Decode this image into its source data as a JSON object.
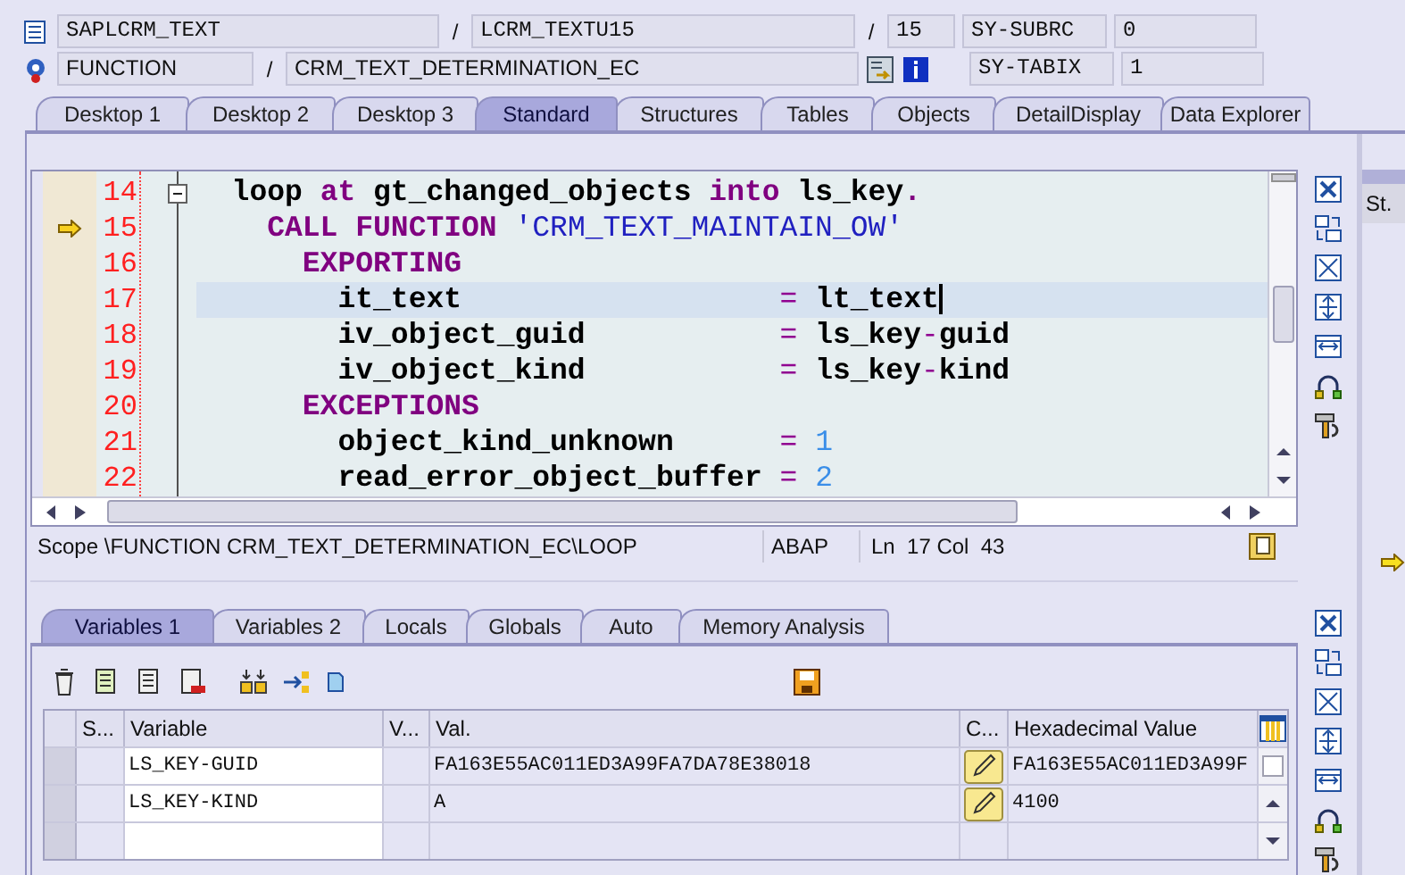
{
  "header": {
    "program": "SAPLCRM_TEXT",
    "sep_1": "/",
    "include": "LCRM_TEXTU15",
    "sep_2": "/",
    "line": "15",
    "subrc_label": "SY-SUBRC",
    "subrc": "0",
    "event_type": "FUNCTION",
    "sep_3": "/",
    "event": "CRM_TEXT_DETERMINATION_EC",
    "tabix_label": "SY-TABIX",
    "tabix": "1"
  },
  "tabs": [
    {
      "label": "Desktop 1",
      "selected": false
    },
    {
      "label": "Desktop 2",
      "selected": false
    },
    {
      "label": "Desktop 3",
      "selected": false
    },
    {
      "label": "Standard",
      "selected": true
    },
    {
      "label": "Structures",
      "selected": false
    },
    {
      "label": "Tables",
      "selected": false
    },
    {
      "label": "Objects",
      "selected": false
    },
    {
      "label": "DetailDisplay",
      "selected": false
    },
    {
      "label": "Data Explorer",
      "selected": false
    }
  ],
  "editor": {
    "lines": [
      {
        "number": "14",
        "current": false,
        "highlighted": false,
        "collapsible": true,
        "segments": [
          {
            "kind": "text",
            "text": "  loop "
          },
          {
            "kind": "keyword",
            "text": "at"
          },
          {
            "kind": "text",
            "text": " gt_changed_objects "
          },
          {
            "kind": "keyword",
            "text": "into"
          },
          {
            "kind": "text",
            "text": " ls_key"
          },
          {
            "kind": "keyword",
            "text": "."
          }
        ]
      },
      {
        "number": "15",
        "current": true,
        "highlighted": false,
        "collapsible": false,
        "segments": [
          {
            "kind": "keyword",
            "text": "    CALL FUNCTION "
          },
          {
            "kind": "string",
            "text": "'CRM_TEXT_MAINTAIN_OW'"
          }
        ]
      },
      {
        "number": "16",
        "current": false,
        "highlighted": false,
        "collapsible": false,
        "segments": [
          {
            "kind": "keyword",
            "text": "      EXPORTING"
          }
        ]
      },
      {
        "number": "17",
        "current": false,
        "highlighted": true,
        "collapsible": false,
        "segments": [
          {
            "kind": "text",
            "text": "        it_text                  "
          },
          {
            "kind": "operator",
            "text": "= "
          },
          {
            "kind": "text",
            "text": "lt_text"
          }
        ]
      },
      {
        "number": "18",
        "current": false,
        "highlighted": false,
        "collapsible": false,
        "segments": [
          {
            "kind": "text",
            "text": "        iv_object_guid           "
          },
          {
            "kind": "operator",
            "text": "= "
          },
          {
            "kind": "text",
            "text": "ls_key"
          },
          {
            "kind": "operator",
            "text": "-"
          },
          {
            "kind": "text",
            "text": "guid"
          }
        ]
      },
      {
        "number": "19",
        "current": false,
        "highlighted": false,
        "collapsible": false,
        "segments": [
          {
            "kind": "text",
            "text": "        iv_object_kind           "
          },
          {
            "kind": "operator",
            "text": "= "
          },
          {
            "kind": "text",
            "text": "ls_key"
          },
          {
            "kind": "operator",
            "text": "-"
          },
          {
            "kind": "text",
            "text": "kind"
          }
        ]
      },
      {
        "number": "20",
        "current": false,
        "highlighted": false,
        "collapsible": false,
        "segments": [
          {
            "kind": "keyword",
            "text": "      EXCEPTIONS"
          }
        ]
      },
      {
        "number": "21",
        "current": false,
        "highlighted": false,
        "collapsible": false,
        "segments": [
          {
            "kind": "text",
            "text": "        object_kind_unknown      "
          },
          {
            "kind": "operator",
            "text": "= "
          },
          {
            "kind": "number",
            "text": "1"
          }
        ]
      },
      {
        "number": "22",
        "current": false,
        "highlighted": false,
        "collapsible": false,
        "segments": [
          {
            "kind": "text",
            "text": "        read_error_object_buffer "
          },
          {
            "kind": "operator",
            "text": "= "
          },
          {
            "kind": "number",
            "text": "2"
          }
        ]
      }
    ],
    "status": {
      "scope": "Scope \\FUNCTION CRM_TEXT_DETERMINATION_EC\\LOOP",
      "language": "ABAP",
      "position": "Ln  17 Col  43"
    }
  },
  "right_panel": {
    "label": "St."
  },
  "variable_tabs": [
    {
      "label": "Variables 1",
      "selected": true
    },
    {
      "label": "Variables 2",
      "selected": false
    },
    {
      "label": "Locals",
      "selected": false
    },
    {
      "label": "Globals",
      "selected": false
    },
    {
      "label": "Auto",
      "selected": false
    },
    {
      "label": "Memory Analysis",
      "selected": false
    }
  ],
  "table": {
    "columns": [
      "S...",
      "Variable",
      "V...",
      "Val.",
      "C...",
      "Hexadecimal Value"
    ],
    "rows": [
      {
        "variable": "LS_KEY-GUID",
        "val": "FA163E55AC011ED3A99FA7DA78E38018",
        "hex": "FA163E55AC011ED3A99F"
      },
      {
        "variable": "LS_KEY-KIND",
        "val": "A",
        "hex": "4100"
      }
    ]
  }
}
